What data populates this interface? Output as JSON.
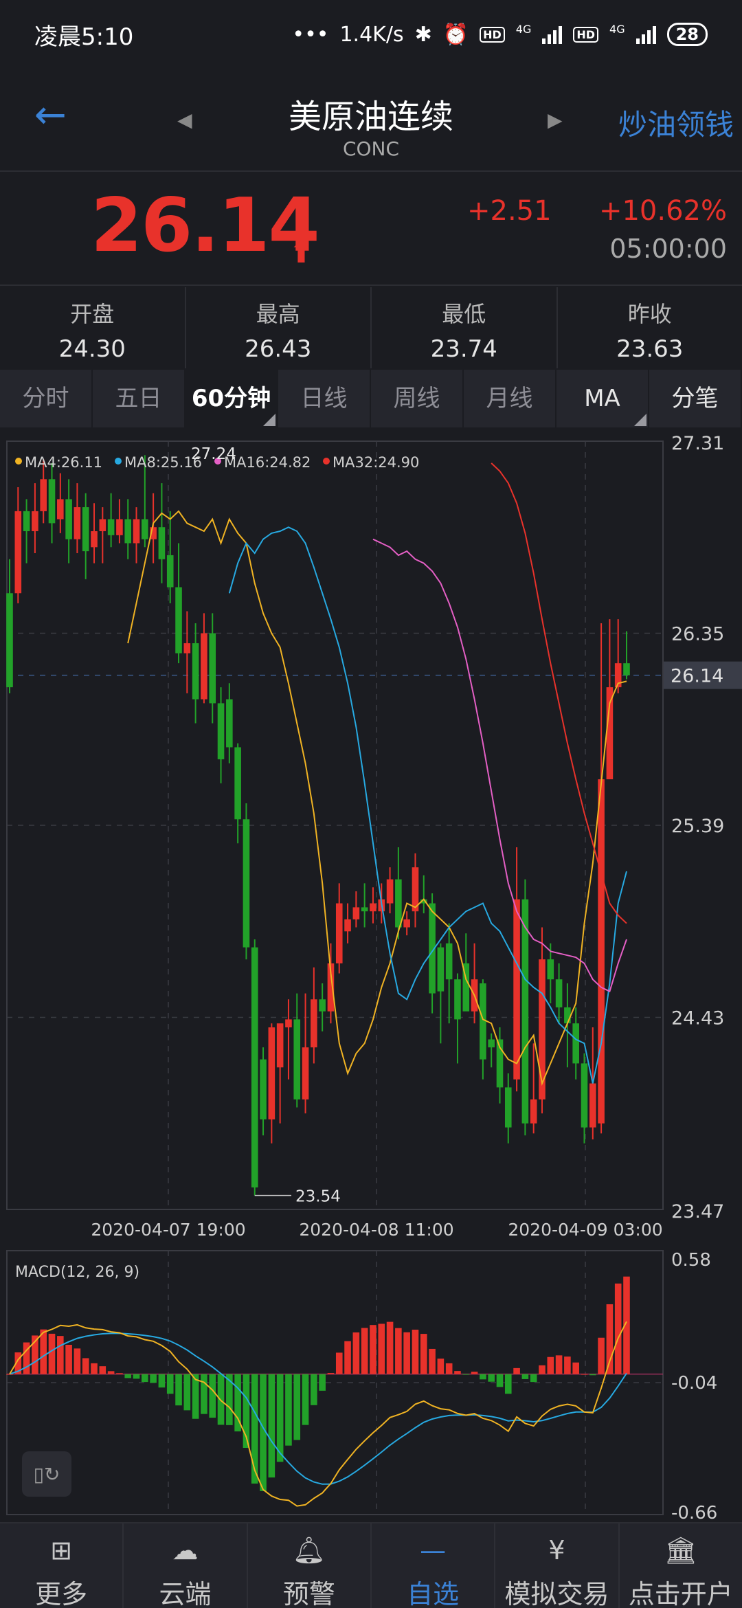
{
  "status": {
    "time": "凌晨5:10",
    "net_speed": "1.4K/s",
    "network1": "4G",
    "network2": "4G",
    "battery": "28"
  },
  "nav": {
    "title": "美原油连续",
    "subtitle": "CONC",
    "promo": "炒油领钱"
  },
  "quote": {
    "price": "26.14",
    "change": "+2.51",
    "change_pct": "+10.62%",
    "time": "05:00:00",
    "up_color": "#e8322b"
  },
  "stats": [
    {
      "label": "开盘",
      "value": "24.30"
    },
    {
      "label": "最高",
      "value": "26.43"
    },
    {
      "label": "最低",
      "value": "23.74"
    },
    {
      "label": "昨收",
      "value": "23.63"
    }
  ],
  "tabs": [
    {
      "label": "分时",
      "active": false
    },
    {
      "label": "五日",
      "active": false
    },
    {
      "label": "60分钟",
      "active": true
    },
    {
      "label": "日线",
      "active": false
    },
    {
      "label": "周线",
      "active": false
    },
    {
      "label": "月线",
      "active": false
    },
    {
      "label": "MA",
      "active": false
    },
    {
      "label": "分笔",
      "active": false
    }
  ],
  "chart_data": [
    {
      "type": "candlestick",
      "ma_legend": [
        {
          "label": "MA4:26.11",
          "color": "#f0b323"
        },
        {
          "label": "MA8:25.16",
          "color": "#27a9e1"
        },
        {
          "label": "MA16:24.82",
          "color": "#e45fc5"
        },
        {
          "label": "MA32:24.90",
          "color": "#e8322b"
        }
      ],
      "y_ticks": [
        "27.31",
        "26.35",
        "25.39",
        "24.43",
        "23.47"
      ],
      "ylim": [
        23.47,
        27.31
      ],
      "current_price": "26.14",
      "high_marker": "27.24",
      "low_marker": "23.54",
      "x_labels": [
        "2020-04-07 19:00",
        "2020-04-08 11:00",
        "2020-04-09 03:00"
      ],
      "candles": [
        [
          26.55,
          26.08,
          26.72,
          26.05
        ],
        [
          26.55,
          26.96,
          27.08,
          26.5
        ],
        [
          26.96,
          26.86,
          27.02,
          26.7
        ],
        [
          26.86,
          26.96,
          27.1,
          26.75
        ],
        [
          26.96,
          27.12,
          27.22,
          26.9
        ],
        [
          27.12,
          26.9,
          27.2,
          26.8
        ],
        [
          26.92,
          27.02,
          27.15,
          26.85
        ],
        [
          27.02,
          26.82,
          27.12,
          26.7
        ],
        [
          26.82,
          26.98,
          27.1,
          26.75
        ],
        [
          26.98,
          26.76,
          27.05,
          26.62
        ],
        [
          26.78,
          26.86,
          27.0,
          26.7
        ],
        [
          26.86,
          26.92,
          26.98,
          26.7
        ],
        [
          26.92,
          26.84,
          27.05,
          26.78
        ],
        [
          26.84,
          26.92,
          27.02,
          26.8
        ],
        [
          26.92,
          26.8,
          27.02,
          26.72
        ],
        [
          26.8,
          26.92,
          26.98,
          26.7
        ],
        [
          26.92,
          26.82,
          27.24,
          26.78
        ],
        [
          26.82,
          26.88,
          27.05,
          26.7
        ],
        [
          26.88,
          26.72,
          27.1,
          26.6
        ],
        [
          26.74,
          26.58,
          26.96,
          26.5
        ],
        [
          26.58,
          26.25,
          26.8,
          26.2
        ],
        [
          26.25,
          26.3,
          26.46,
          26.05
        ],
        [
          26.3,
          26.02,
          26.4,
          25.9
        ],
        [
          26.02,
          26.35,
          26.45,
          26.0
        ],
        [
          26.35,
          26.0,
          26.45,
          25.9
        ],
        [
          26.0,
          25.72,
          26.08,
          25.6
        ],
        [
          26.02,
          25.78,
          26.1,
          25.7
        ],
        [
          25.78,
          25.42,
          25.8,
          25.3
        ],
        [
          25.42,
          24.78,
          25.5,
          24.72
        ],
        [
          24.78,
          23.58,
          24.82,
          23.54
        ],
        [
          24.22,
          23.92,
          24.28,
          23.84
        ],
        [
          23.92,
          24.38,
          24.4,
          23.8
        ],
        [
          24.18,
          24.4,
          24.3,
          23.9
        ],
        [
          24.38,
          24.42,
          24.52,
          24.12
        ],
        [
          24.42,
          24.02,
          24.55,
          23.98
        ],
        [
          24.02,
          24.28,
          24.55,
          23.95
        ],
        [
          24.28,
          24.52,
          24.68,
          24.2
        ],
        [
          24.52,
          24.46,
          24.6,
          24.36
        ],
        [
          24.46,
          24.7,
          24.8,
          24.4
        ],
        [
          24.7,
          25.0,
          25.1,
          24.65
        ],
        [
          24.86,
          24.92,
          25.0,
          24.8
        ],
        [
          24.92,
          24.98,
          25.06,
          24.88
        ],
        [
          24.98,
          24.96,
          25.1,
          24.88
        ],
        [
          24.96,
          25.0,
          25.08,
          24.9
        ],
        [
          24.96,
          25.02,
          25.1,
          24.9
        ],
        [
          25.0,
          25.12,
          25.18,
          24.95
        ],
        [
          25.12,
          24.88,
          25.28,
          24.82
        ],
        [
          24.88,
          24.92,
          24.96,
          24.84
        ],
        [
          24.96,
          25.18,
          25.25,
          24.88
        ],
        [
          25.02,
          25.0,
          25.14,
          24.95
        ],
        [
          25.0,
          24.55,
          25.05,
          24.45
        ],
        [
          24.78,
          24.56,
          24.8,
          24.3
        ],
        [
          24.8,
          24.62,
          24.9,
          24.4
        ],
        [
          24.62,
          24.42,
          24.65,
          24.2
        ],
        [
          24.7,
          24.46,
          24.85,
          24.5
        ],
        [
          24.46,
          24.62,
          24.8,
          24.4
        ],
        [
          24.6,
          24.22,
          24.62,
          24.12
        ],
        [
          24.32,
          24.28,
          24.35,
          24.18
        ],
        [
          24.32,
          24.08,
          24.38,
          24.0
        ],
        [
          24.08,
          23.88,
          24.15,
          23.8
        ],
        [
          24.12,
          25.02,
          25.28,
          24.06
        ],
        [
          25.02,
          23.9,
          25.12,
          23.84
        ],
        [
          23.9,
          24.02,
          24.3,
          23.85
        ],
        [
          24.02,
          24.72,
          24.88,
          23.95
        ],
        [
          24.72,
          24.62,
          24.8,
          24.5
        ],
        [
          24.62,
          24.48,
          24.7,
          24.4
        ],
        [
          24.48,
          24.4,
          24.6,
          24.18
        ],
        [
          24.4,
          24.2,
          24.48,
          24.12
        ],
        [
          24.2,
          23.88,
          24.25,
          23.8
        ],
        [
          23.88,
          24.1,
          24.38,
          23.82
        ],
        [
          23.9,
          25.62,
          26.4,
          23.85
        ],
        [
          25.62,
          26.08,
          26.42,
          25.98
        ],
        [
          26.08,
          26.2,
          26.42,
          26.05
        ],
        [
          26.2,
          26.14,
          26.36,
          26.12
        ]
      ],
      "ma": {
        "MA4": [
          26.3,
          26.5,
          26.7,
          26.9,
          26.95,
          26.92,
          26.96,
          26.9,
          26.88,
          26.86,
          26.92,
          26.8,
          26.92,
          26.85,
          26.8,
          26.6,
          26.45,
          26.35,
          26.28,
          26.1,
          25.9,
          25.7,
          25.45,
          25.1,
          24.65,
          24.3,
          24.15,
          24.25,
          24.3,
          24.42,
          24.58,
          24.7,
          24.86,
          25.0,
          24.98,
          25.02,
          24.96,
          24.92,
          24.88,
          24.8,
          24.62,
          24.54,
          24.42,
          24.4,
          24.28,
          24.22,
          24.2,
          24.28,
          24.34,
          24.1,
          24.2,
          24.3,
          24.4,
          24.5,
          24.9,
          25.2,
          25.6,
          26.0,
          26.1,
          26.11
        ],
        "MA8": [
          26.55,
          26.7,
          26.8,
          26.75,
          26.82,
          26.85,
          26.86,
          26.88,
          26.86,
          26.8,
          26.68,
          26.55,
          26.42,
          26.28,
          26.1,
          25.88,
          25.6,
          25.3,
          25.0,
          24.75,
          24.55,
          24.52,
          24.62,
          24.7,
          24.76,
          24.82,
          24.88,
          24.92,
          24.96,
          24.98,
          25.0,
          24.9,
          24.86,
          24.78,
          24.7,
          24.62,
          24.58,
          24.55,
          24.48,
          24.4,
          24.36,
          24.32,
          24.3,
          24.1,
          24.3,
          24.6,
          25.0,
          25.16
        ],
        "MA16": [
          26.82,
          26.8,
          26.78,
          26.74,
          26.76,
          26.72,
          26.7,
          26.66,
          26.6,
          26.5,
          26.38,
          26.22,
          26.02,
          25.8,
          25.56,
          25.32,
          25.1,
          24.96,
          24.88,
          24.82,
          24.8,
          24.76,
          24.75,
          24.74,
          24.73,
          24.7,
          24.62,
          24.58,
          24.56,
          24.7,
          24.82
        ],
        "MA32": [
          27.2,
          27.16,
          27.1,
          27.0,
          26.85,
          26.65,
          26.42,
          26.2,
          26.0,
          25.8,
          25.62,
          25.45,
          25.3,
          25.15,
          25.0,
          24.94,
          24.9
        ]
      }
    },
    {
      "type": "macd",
      "title": "MACD(12, 26, 9)",
      "y_ticks": [
        "0.58",
        "-0.04",
        "-0.66"
      ],
      "ylim": [
        -0.66,
        0.58
      ]
    }
  ],
  "bottom_nav": [
    {
      "label": "更多",
      "icon": "grid-icon"
    },
    {
      "label": "云端",
      "icon": "cloud-icon"
    },
    {
      "label": "预警",
      "icon": "bell-icon"
    },
    {
      "label": "自选",
      "icon": "minus-icon",
      "active": true
    },
    {
      "label": "模拟交易",
      "icon": "yen-icon"
    },
    {
      "label": "点击开户",
      "icon": "bank-icon"
    }
  ]
}
